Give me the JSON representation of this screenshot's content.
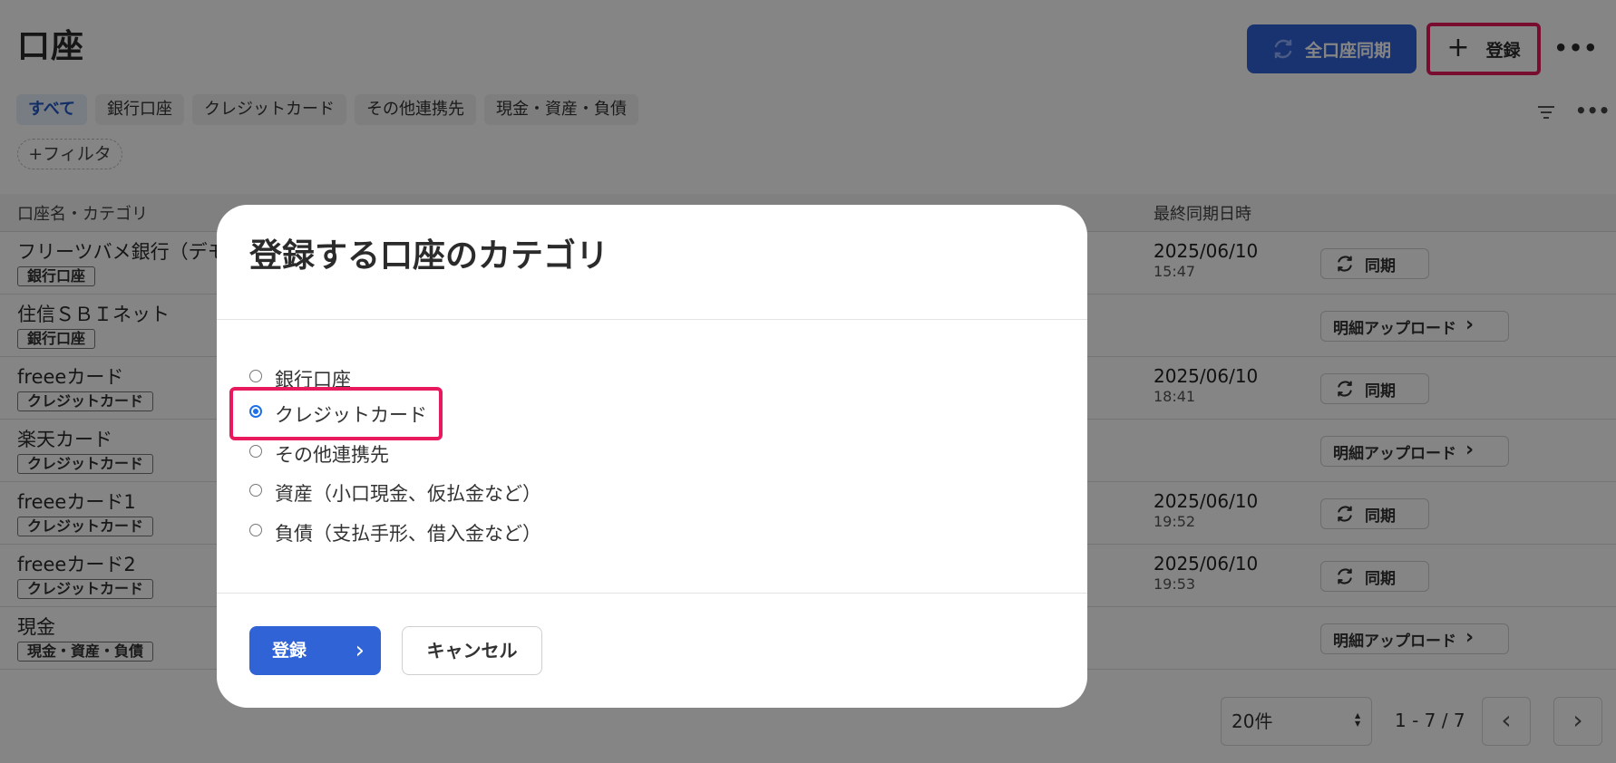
{
  "page": {
    "title": "口座"
  },
  "header": {
    "sync_all_label": "全口座同期",
    "register_label": "登録",
    "more_label": "•••"
  },
  "tabs": [
    {
      "label": "すべて",
      "active": true
    },
    {
      "label": "銀行口座",
      "active": false
    },
    {
      "label": "クレジットカード",
      "active": false
    },
    {
      "label": "その他連携先",
      "active": false
    },
    {
      "label": "現金・資産・負債",
      "active": false
    }
  ],
  "filter": {
    "add_label": "+フィルタ"
  },
  "table": {
    "header": {
      "name": "口座名・カテゴリ",
      "last_sync": "最終同期日時"
    },
    "rows": [
      {
        "name": "フリーツバメ銀行（デモ",
        "category": "銀行口座",
        "date": "2025/06/10",
        "time": "15:47",
        "action": "同期"
      },
      {
        "name": "住信ＳＢＩネット",
        "category": "銀行口座",
        "date": "",
        "time": "",
        "action": "明細アップロード"
      },
      {
        "name": "freeeカード",
        "category": "クレジットカード",
        "date": "2025/06/10",
        "time": "18:41",
        "action": "同期"
      },
      {
        "name": "楽天カード",
        "category": "クレジットカード",
        "date": "",
        "time": "",
        "action": "明細アップロード"
      },
      {
        "name": "freeeカード1",
        "category": "クレジットカード",
        "date": "2025/06/10",
        "time": "19:52",
        "action": "同期"
      },
      {
        "name": "freeeカード2",
        "category": "クレジットカード",
        "date": "2025/06/10",
        "time": "19:53",
        "action": "同期"
      },
      {
        "name": "現金",
        "category": "現金・資産・負債",
        "date": "",
        "time": "",
        "action": "明細アップロード"
      }
    ]
  },
  "pagination": {
    "page_size": "20件",
    "range": "1 - 7 / 7",
    "prev": "‹",
    "next": "›"
  },
  "modal": {
    "title": "登録する口座のカテゴリ",
    "options": [
      {
        "label": "銀行口座",
        "checked": false
      },
      {
        "label": "クレジットカード",
        "checked": true
      },
      {
        "label": "その他連携先",
        "checked": false
      },
      {
        "label": "資産（小口現金、仮払金など）",
        "checked": false
      },
      {
        "label": "負債（支払手形、借入金など）",
        "checked": false
      }
    ],
    "register_label": "登録",
    "cancel_label": "キャンセル"
  },
  "colors": {
    "primary": "#2f63d6",
    "highlight": "#e8195c",
    "radio_checked": "#1d70e8"
  }
}
